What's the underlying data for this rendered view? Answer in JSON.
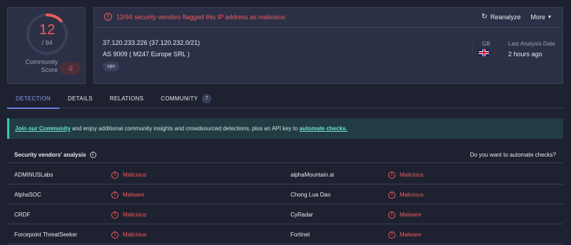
{
  "score": {
    "detections": "12",
    "total": "/ 94",
    "detection_fraction": 0.1277,
    "community_label_line1": "Community",
    "community_label_line2": "Score",
    "community_value": "-2",
    "colors": {
      "malicious": "#f15b5b",
      "ring_track": "#3a4058"
    }
  },
  "summary": {
    "alert_text": "12/94 security vendors flagged this IP address as malicious",
    "reanalyze_label": "Reanalyze",
    "more_label": "More",
    "ip_line": "37.120.233.226  (37.120.232.0/21)",
    "as_line": "AS 9009  ( M247 Europe SRL )",
    "tag": "vpn",
    "country_code": "GB",
    "last_analysis_label": "Last Analysis Date",
    "last_analysis_value": "2 hours ago"
  },
  "tabs": [
    {
      "label": "DETECTION",
      "active": true
    },
    {
      "label": "DETAILS",
      "active": false
    },
    {
      "label": "RELATIONS",
      "active": false
    },
    {
      "label": "COMMUNITY",
      "active": false,
      "badge": "7"
    }
  ],
  "banner": {
    "link1": "Join our Community",
    "middle": " and enjoy additional community insights and crowdsourced detections, plus an API key to ",
    "link2": "automate checks."
  },
  "vendors": {
    "title": "Security vendors' analysis",
    "automate_prompt": "Do you want to automate checks?",
    "rows": [
      {
        "left_vendor": "ADMINUSLabs",
        "left_verdict": "Malicious",
        "right_vendor": "alphaMountain.ai",
        "right_verdict": "Malicious"
      },
      {
        "left_vendor": "AlphaSOC",
        "left_verdict": "Malware",
        "right_vendor": "Chong Lua Dao",
        "right_verdict": "Malicious"
      },
      {
        "left_vendor": "CRDF",
        "left_verdict": "Malicious",
        "right_vendor": "CyRadar",
        "right_verdict": "Malware"
      },
      {
        "left_vendor": "Forcepoint ThreatSeeker",
        "left_verdict": "Malicious",
        "right_vendor": "Fortinet",
        "right_verdict": "Malware"
      }
    ]
  }
}
